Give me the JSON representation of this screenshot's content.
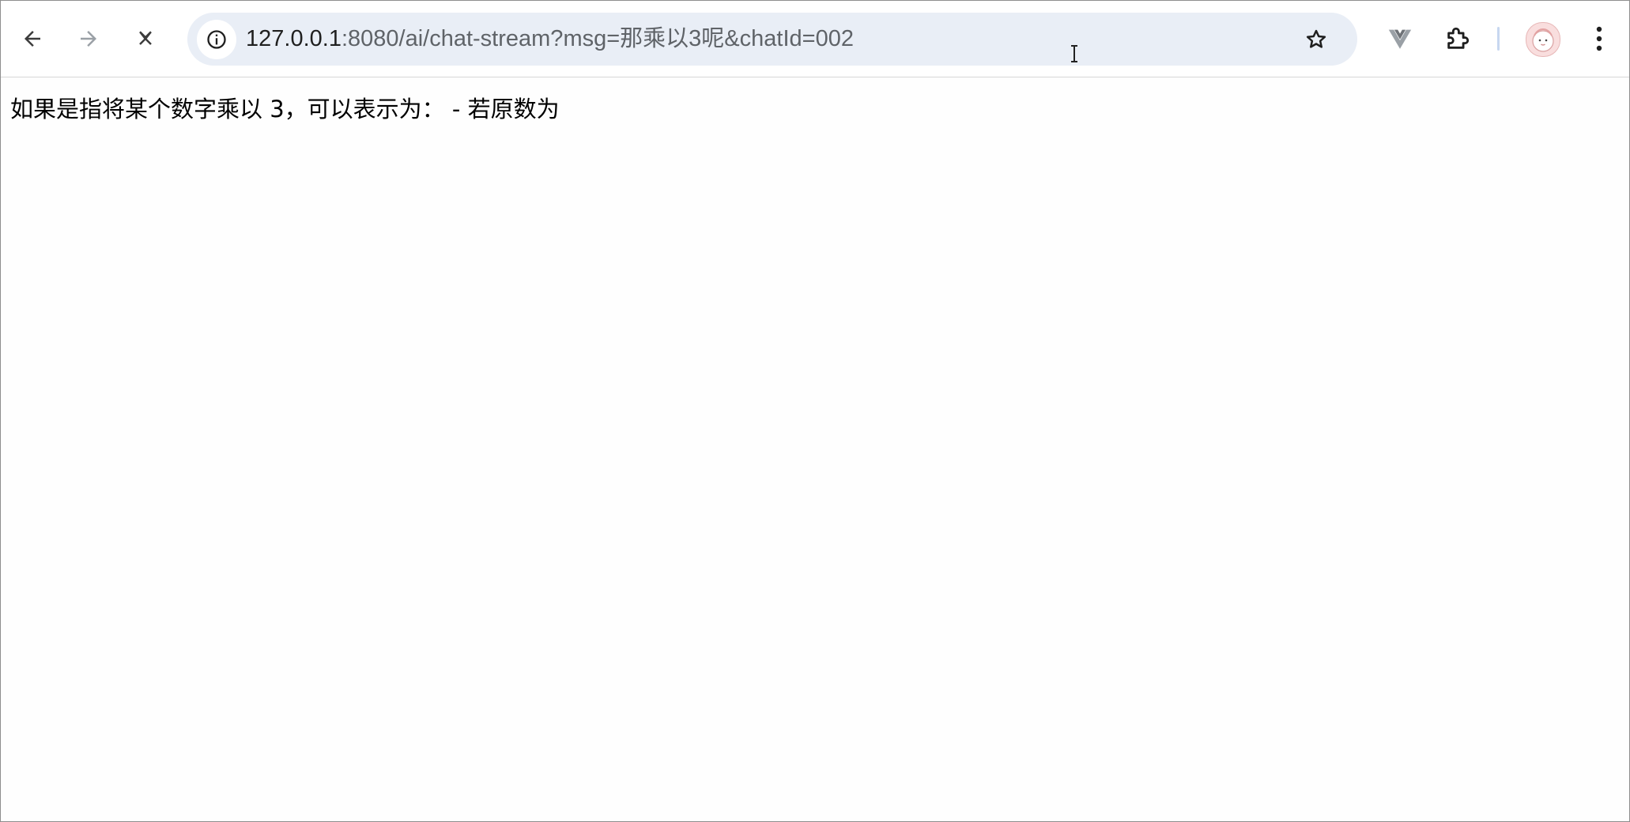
{
  "browser": {
    "nav": {
      "back_icon": "arrow-left-icon",
      "forward_icon": "arrow-right-icon",
      "stop_icon": "close-icon"
    },
    "omnibox": {
      "url_host": "127.0.0.1",
      "url_rest": ":8080/ai/chat-stream?msg=那乘以3呢&chatId=002",
      "site_info_icon": "info-icon",
      "bookmark_icon": "star-icon"
    },
    "extensions": [
      {
        "name": "vue-devtools-icon",
        "color": "#9aa0a6"
      },
      {
        "name": "puzzle-extensions-icon",
        "color": "#1f1f1f"
      }
    ],
    "profile_icon": "avatar",
    "menu_icon": "more-vert-icon"
  },
  "page": {
    "response_text": "如果是指将某个数字乘以 3，可以表示为： - 若原数为"
  }
}
